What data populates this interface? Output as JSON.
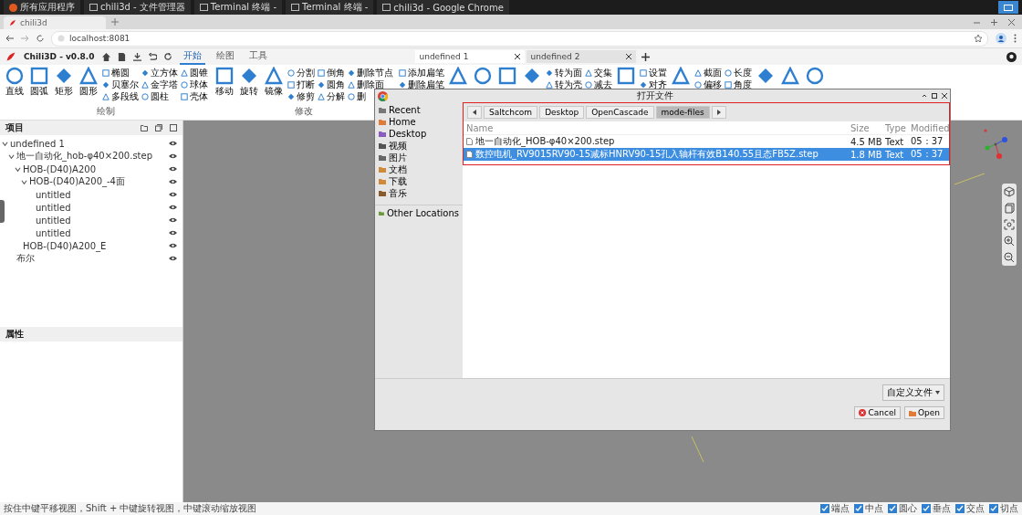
{
  "taskbar": {
    "items": [
      {
        "label": "所有应用程序"
      },
      {
        "label": "chili3d - 文件管理器"
      },
      {
        "label": "Terminal 终端 -"
      },
      {
        "label": "Terminal 终端 -"
      },
      {
        "label": "chili3d - Google Chrome"
      }
    ]
  },
  "browser": {
    "tab": "chili3d",
    "address": "localhost:8081"
  },
  "app": {
    "title": "Chili3D - v0.8.0",
    "tabs": [
      {
        "label": "开始",
        "selected": true
      },
      {
        "label": "绘图",
        "selected": false
      },
      {
        "label": "工具",
        "selected": false
      }
    ],
    "documents": [
      {
        "label": "undefined 1",
        "selected": true
      },
      {
        "label": "undefined 2",
        "selected": false
      }
    ]
  },
  "ribbon": {
    "groups": [
      {
        "label": "绘制",
        "items": [
          {
            "kind": "large",
            "label": "直线"
          },
          {
            "kind": "large",
            "label": "圆弧"
          },
          {
            "kind": "large",
            "label": "矩形"
          },
          {
            "kind": "large",
            "label": "圆形"
          },
          {
            "kind": "column",
            "labels": [
              "椭圆",
              "贝塞尔",
              "多段线"
            ]
          },
          {
            "kind": "column",
            "labels": [
              "立方体",
              "金字塔",
              "圆柱"
            ]
          },
          {
            "kind": "column",
            "labels": [
              "圆锥",
              "球体",
              "壳体"
            ]
          }
        ]
      },
      {
        "label": "修改",
        "items": [
          {
            "kind": "large",
            "label": "移动"
          },
          {
            "kind": "large",
            "label": "旋转"
          },
          {
            "kind": "large",
            "label": "镜像"
          },
          {
            "kind": "column",
            "labels": [
              "分割",
              "打断",
              "修剪"
            ]
          },
          {
            "kind": "column",
            "labels": [
              "倒角",
              "圆角",
              "分解"
            ]
          },
          {
            "kind": "column",
            "labels": [
              "删除节点",
              "删除面",
              "删"
            ]
          }
        ]
      },
      {
        "items": [
          {
            "kind": "column",
            "labels": [
              "添加扁笔",
              "删除扁笔"
            ]
          },
          {
            "kind": "large"
          },
          {
            "kind": "large"
          },
          {
            "kind": "large"
          },
          {
            "kind": "large"
          },
          {
            "kind": "column",
            "labels": [
              "转为面",
              "转为壳"
            ]
          },
          {
            "kind": "column",
            "labels": [
              "交集",
              "减去"
            ]
          },
          {
            "kind": "large"
          },
          {
            "kind": "column",
            "labels": [
              "设置",
              "对齐"
            ]
          },
          {
            "kind": "large"
          },
          {
            "kind": "column",
            "labels": [
              "截面",
              "偏移"
            ]
          },
          {
            "kind": "column",
            "labels": [
              "长度",
              "角度"
            ]
          },
          {
            "kind": "large"
          },
          {
            "kind": "large"
          },
          {
            "kind": "large"
          }
        ]
      }
    ]
  },
  "project_panel": {
    "title": "项目",
    "tree": [
      {
        "label": "undefined 1",
        "expanded": true,
        "children": [
          {
            "label": "地一自动化_hob-φ40×200.step",
            "expanded": true,
            "children": [
              {
                "label": "HOB-(D40)A200",
                "expanded": true,
                "children": [
                  {
                    "label": "HOB-(D40)A200_-4面",
                    "expanded": true,
                    "children": [
                      {
                        "label": "untitled"
                      },
                      {
                        "label": "untitled"
                      },
                      {
                        "label": "untitled"
                      },
                      {
                        "label": "untitled"
                      }
                    ]
                  }
                ]
              },
              {
                "label": "HOB-(D40)A200_E"
              }
            ]
          },
          {
            "label": "布尔"
          }
        ]
      }
    ]
  },
  "properties_panel": {
    "title": "属性"
  },
  "dialog": {
    "title": "打开文件",
    "places": [
      {
        "label": "Recent"
      },
      {
        "label": "Home"
      },
      {
        "label": "Desktop"
      },
      {
        "label": "视频"
      },
      {
        "label": "图片"
      },
      {
        "label": "文档"
      },
      {
        "label": "下载"
      },
      {
        "label": "音乐"
      },
      {
        "label": "Other Locations"
      }
    ],
    "path": [
      {
        "label": "Saltchcom",
        "selected": false
      },
      {
        "label": "Desktop",
        "selected": false
      },
      {
        "label": "OpenCascade",
        "selected": false
      },
      {
        "label": "mode-files",
        "selected": true
      }
    ],
    "columns": [
      "Name",
      "Size",
      "Type",
      "Modified"
    ],
    "files": [
      {
        "name": "地一自动化_HOB-φ40×200.step",
        "size": "4.5 MB",
        "type": "Text",
        "modified": "05：37",
        "selected": false
      },
      {
        "name": "数控电机_RV9015RV90-15减标HNRV90-15孔入轴杆有效B140.55且态FB5Z.step",
        "size": "1.8 MB",
        "type": "Text",
        "modified": "05：37",
        "selected": true
      }
    ],
    "filter": "自定义文件",
    "buttons": [
      {
        "label": "Cancel",
        "kind": "cancel"
      },
      {
        "label": "Open",
        "kind": "open"
      }
    ]
  },
  "status_bar": {
    "hint": "按住中键平移视图，Shift + 中键旋转视图，中键滚动缩放视图",
    "snaps": [
      {
        "label": "端点",
        "checked": true
      },
      {
        "label": "中点",
        "checked": true
      },
      {
        "label": "圆心",
        "checked": true
      },
      {
        "label": "垂点",
        "checked": true
      },
      {
        "label": "交点",
        "checked": true
      },
      {
        "label": "切点",
        "checked": true
      }
    ]
  }
}
